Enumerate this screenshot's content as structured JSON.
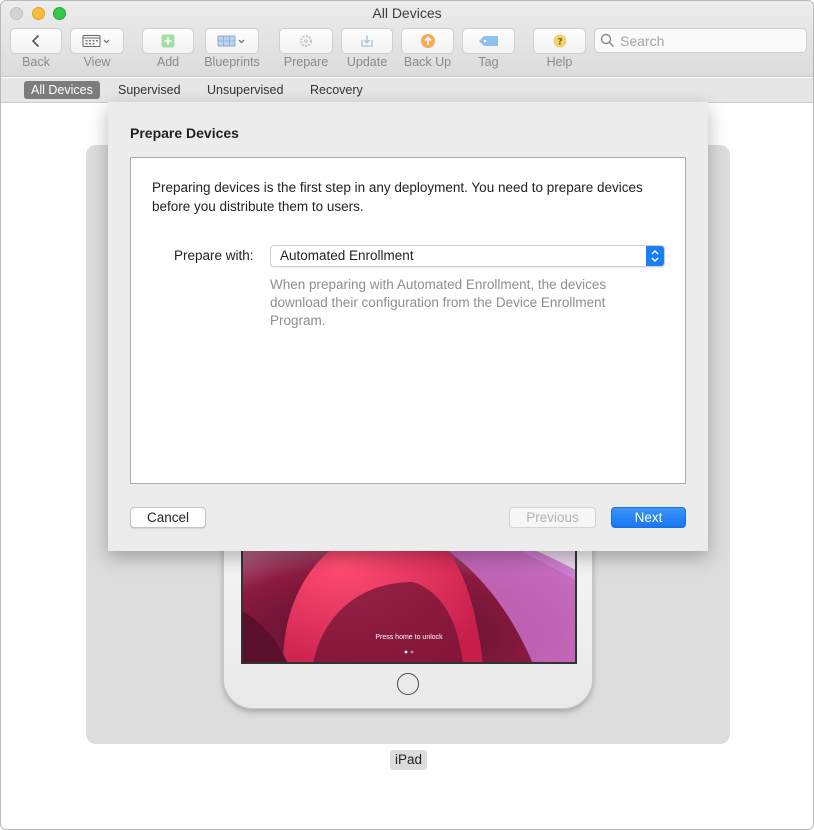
{
  "window": {
    "title": "All Devices"
  },
  "toolbar": {
    "back_label": "Back",
    "view_label": "View",
    "add_label": "Add",
    "blueprints_label": "Blueprints",
    "prepare_label": "Prepare",
    "update_label": "Update",
    "backup_label": "Back Up",
    "tag_label": "Tag",
    "help_label": "Help",
    "search_placeholder": "Search"
  },
  "filters": {
    "all": "All Devices",
    "supervised": "Supervised",
    "unsupervised": "Unsupervised",
    "recovery": "Recovery",
    "active": "All Devices"
  },
  "sheet": {
    "title": "Prepare Devices",
    "intro": "Preparing devices is the first step in any deployment. You need to prepare devices before you distribute them to users.",
    "prepare_with_label": "Prepare with:",
    "prepare_with_value": "Automated Enrollment",
    "help_text": "When preparing with Automated Enrollment, the devices download their configuration from the Device Enrollment Program.",
    "cancel_label": "Cancel",
    "previous_label": "Previous",
    "next_label": "Next"
  },
  "device": {
    "name": "iPad",
    "lock_text": "Press home to unlock"
  },
  "colors": {
    "accent": "#1d7ff3",
    "active_filter": "#7c7c7c"
  }
}
